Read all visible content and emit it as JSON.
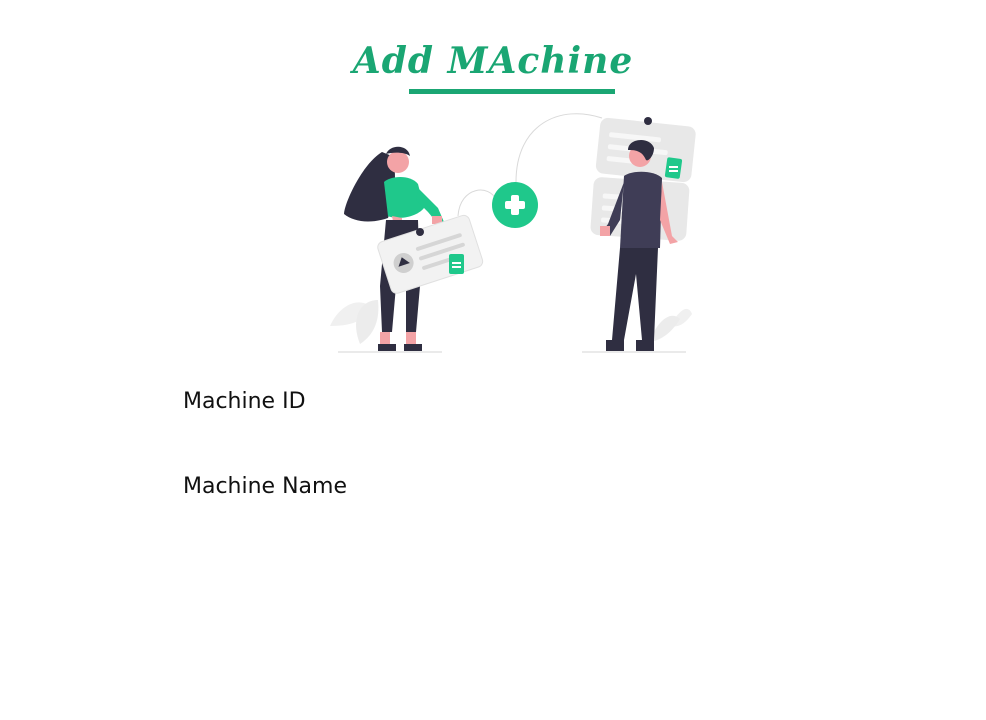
{
  "page": {
    "title": "Add MAchine"
  },
  "illustration": {
    "icon": "add-circle-icon"
  },
  "form": {
    "machine_id_label": "Machine ID",
    "machine_name_label": "Machine Name"
  },
  "colors": {
    "accent": "#1aa673",
    "dark": "#2f2e41",
    "skin": "#f3a3a6",
    "light_gray": "#e6e6e6"
  }
}
